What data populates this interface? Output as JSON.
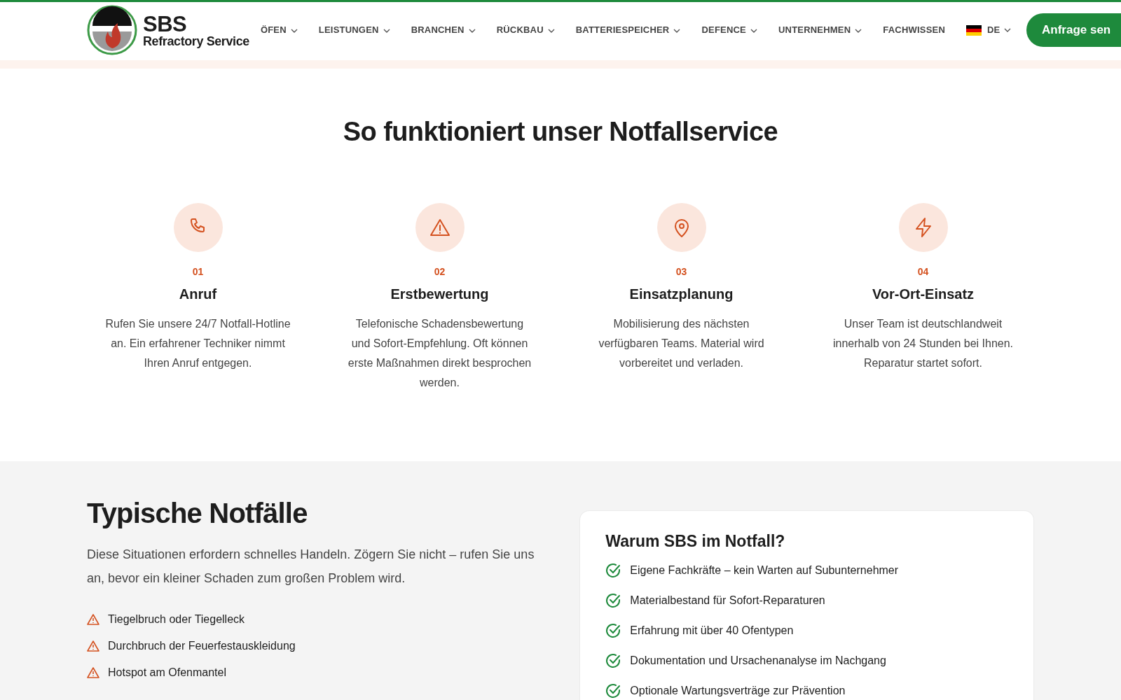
{
  "header": {
    "logo": {
      "name": "SBS",
      "subtitle": "Refractory Service"
    },
    "nav": [
      {
        "label": "ÖFEN",
        "dropdown": true
      },
      {
        "label": "LEISTUNGEN",
        "dropdown": true
      },
      {
        "label": "BRANCHEN",
        "dropdown": true
      },
      {
        "label": "RÜCKBAU",
        "dropdown": true
      },
      {
        "label": "BATTERIESPEICHER",
        "dropdown": true
      },
      {
        "label": "DEFENCE",
        "dropdown": true
      },
      {
        "label": "UNTERNEHMEN",
        "dropdown": true
      },
      {
        "label": "FACHWISSEN",
        "dropdown": false
      }
    ],
    "language": "DE",
    "cta": "Anfrage sen"
  },
  "process": {
    "title": "So funktioniert unser Notfallservice",
    "steps": [
      {
        "number": "01",
        "title": "Anruf",
        "text": "Rufen Sie unsere 24/7 Notfall-Hotline an. Ein erfahrener Techniker nimmt Ihren Anruf entgegen."
      },
      {
        "number": "02",
        "title": "Erstbewertung",
        "text": "Telefonische Schadensbewertung und Sofort-Empfehlung. Oft können erste Maßnahmen direkt besprochen werden."
      },
      {
        "number": "03",
        "title": "Einsatzplanung",
        "text": "Mobilisierung des nächsten verfügbaren Teams. Material wird vorbereitet und verladen."
      },
      {
        "number": "04",
        "title": "Vor-Ort-Einsatz",
        "text": "Unser Team ist deutschlandweit innerhalb von 24 Stunden bei Ihnen. Reparatur startet sofort."
      }
    ]
  },
  "emergencies": {
    "title": "Typische Notfälle",
    "intro": "Diese Situationen erfordern schnelles Handeln. Zögern Sie nicht – rufen Sie uns an, bevor ein kleiner Schaden zum großen Problem wird.",
    "items": [
      "Tiegelbruch oder Tiegelleck",
      "Durchbruch der Feuerfestauskleidung",
      "Hotspot am Ofenmantel"
    ]
  },
  "why_card": {
    "title": "Warum SBS im Notfall?",
    "items": [
      "Eigene Fachkräfte – kein Warten auf Subunternehmer",
      "Materialbestand für Sofort-Reparaturen",
      "Erfahrung mit über 40 Ofentypen",
      "Dokumentation und Ursachenanalyse im Nachgang",
      "Optionale Wartungsverträge zur Prävention"
    ]
  }
}
